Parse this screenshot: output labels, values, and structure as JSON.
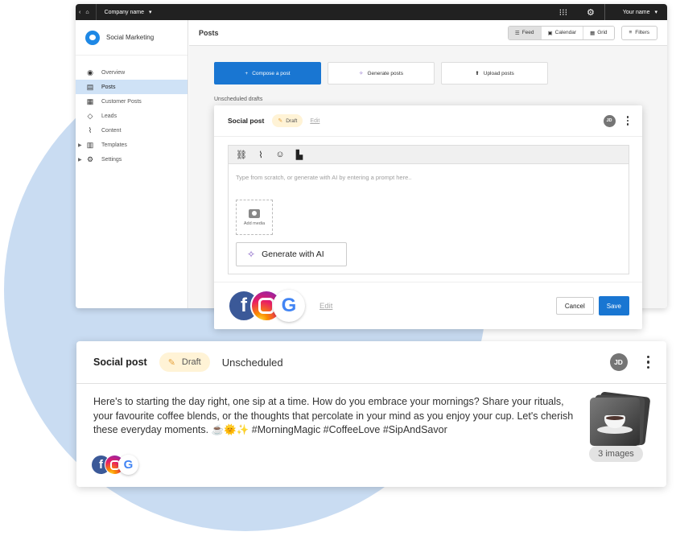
{
  "topbar": {
    "company": "Company name",
    "user": "Your name"
  },
  "sidebar": {
    "brand": "Social Marketing",
    "items": [
      {
        "label": "Overview",
        "icon": "compass-icon",
        "active": false,
        "expandable": false
      },
      {
        "label": "Posts",
        "icon": "chat-icon",
        "active": true,
        "expandable": false
      },
      {
        "label": "Customer Posts",
        "icon": "customer-posts-icon",
        "active": false,
        "expandable": false
      },
      {
        "label": "Leads",
        "icon": "diamond-icon",
        "active": false,
        "expandable": false
      },
      {
        "label": "Content",
        "icon": "rss-icon",
        "active": false,
        "expandable": false
      },
      {
        "label": "Templates",
        "icon": "chart-icon",
        "active": false,
        "expandable": true
      },
      {
        "label": "Settings",
        "icon": "gear-icon",
        "active": false,
        "expandable": true
      }
    ]
  },
  "main": {
    "title": "Posts",
    "views": [
      "Feed",
      "Calendar",
      "Grid"
    ],
    "active_view": "Feed",
    "filters_label": "Filters",
    "actions": {
      "compose": "Compose a post",
      "generate": "Generate posts",
      "upload": "Upload posts"
    },
    "section_label": "Unscheduled drafts"
  },
  "composer": {
    "title": "Social post",
    "status_chip": "Draft",
    "edit_link": "Edit",
    "avatar": "JD",
    "placeholder": "Type from scratch, or generate with AI by entering a prompt here..",
    "add_media": "Add media",
    "generate_ai": "Generate with AI",
    "footer_edit": "Edit",
    "cancel": "Cancel",
    "save": "Save"
  },
  "post": {
    "title": "Social post",
    "status_chip": "Draft",
    "schedule_status": "Unscheduled",
    "avatar": "JD",
    "body": "Here's to starting the day right, one sip at a time. How do you embrace your mornings? Share your rituals, your favourite coffee blends, or the thoughts that percolate in your mind as you enjoy your cup. Let's cherish these everyday moments. ☕🌞✨ #MorningMagic #CoffeeLove #SipAndSavor",
    "image_count": "3 images"
  },
  "colors": {
    "accent": "#1976d2",
    "sidebar_active": "#cfe2f6",
    "draft_chip": "#fff3d6",
    "background_circle": "#c9dcf2",
    "topbar": "#212121"
  }
}
